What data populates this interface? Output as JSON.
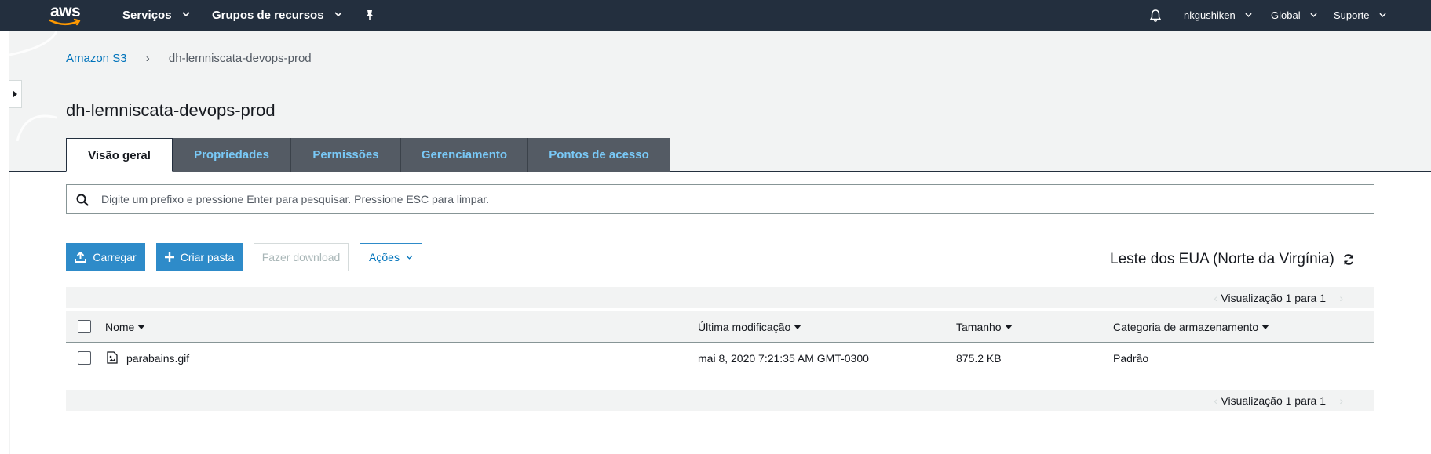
{
  "topnav": {
    "logo_text": "aws",
    "services": "Serviços",
    "resource_groups": "Grupos de recursos",
    "user": "nkgushiken",
    "region": "Global",
    "support": "Suporte"
  },
  "breadcrumb": {
    "root": "Amazon S3",
    "separator": "›",
    "current": "dh-lemniscata-devops-prod"
  },
  "page_title": "dh-lemniscata-devops-prod",
  "tabs": [
    {
      "label": "Visão geral",
      "active": true
    },
    {
      "label": "Propriedades",
      "active": false
    },
    {
      "label": "Permissões",
      "active": false
    },
    {
      "label": "Gerenciamento",
      "active": false
    },
    {
      "label": "Pontos de acesso",
      "active": false
    }
  ],
  "search": {
    "placeholder": "Digite um prefixo e pressione Enter para pesquisar. Pressione ESC para limpar.",
    "value": ""
  },
  "actions": {
    "upload": "Carregar",
    "create_folder": "Criar pasta",
    "download": "Fazer download",
    "actions_menu": "Ações"
  },
  "region_label": "Leste dos EUA (Norte da Virgínia)",
  "pager": {
    "text": "Visualização 1 para 1"
  },
  "table": {
    "columns": [
      "Nome",
      "Última modificação",
      "Tamanho",
      "Categoria de armazenamento"
    ],
    "rows": [
      {
        "name": "parabains.gif",
        "modified": "mai 8, 2020 7:21:35 AM GMT-0300",
        "size": "875.2 KB",
        "storage_class": "Padrão"
      }
    ]
  },
  "colors": {
    "nav_bg": "#232f3e",
    "accent_blue": "#0073bb",
    "primary_button": "#2e8bc9",
    "tab_inactive_bg": "#545b64",
    "tab_inactive_text": "#79c9f7",
    "aws_orange": "#ff9900"
  }
}
